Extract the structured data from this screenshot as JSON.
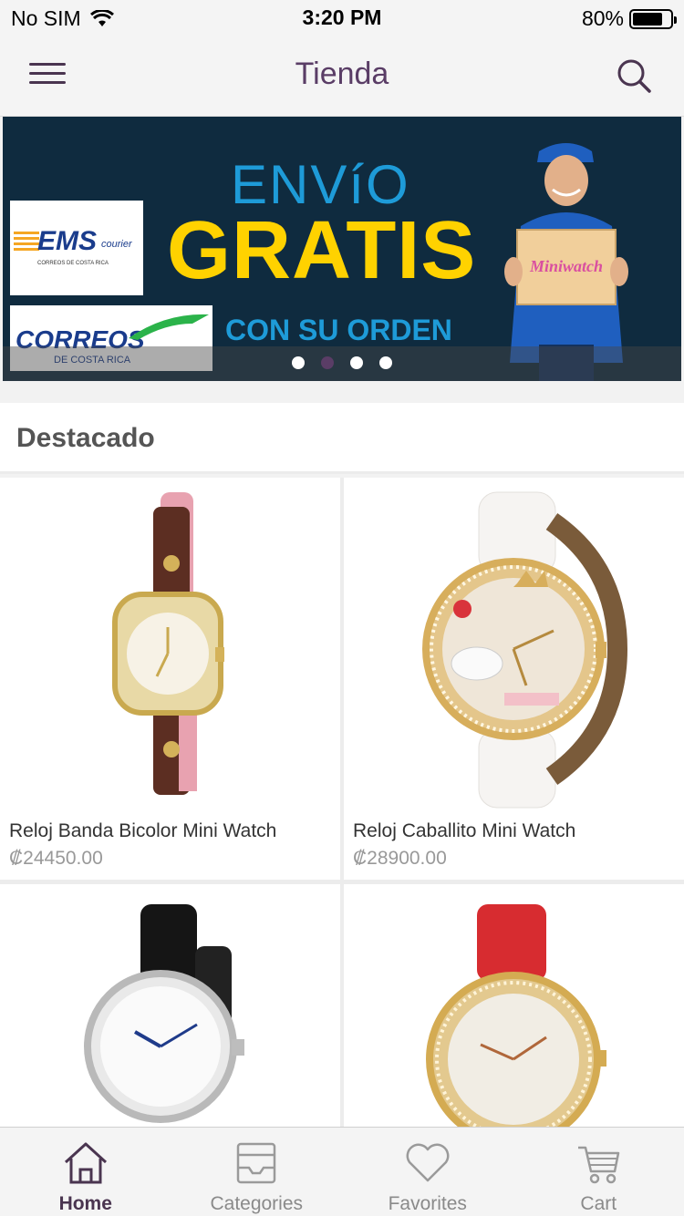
{
  "status_bar": {
    "carrier": "No SIM",
    "time": "3:20 PM",
    "battery": "80%",
    "battery_level": 0.8
  },
  "nav": {
    "title": "Tienda"
  },
  "banner": {
    "line1": "ENVíO",
    "line2": "GRATIS",
    "line3": "CON SU ORDEN",
    "ems_logo": "EMS",
    "ems_courier": "courier",
    "ems_sub": "CORREOS DE COSTA RICA",
    "correos_logo": "CORREOS",
    "correos_sub": "DE COSTA RICA",
    "box_brand": "Miniwatch",
    "dot_count": 4,
    "active_dot": 1
  },
  "section": {
    "title": "Destacado"
  },
  "products": [
    {
      "name": "Reloj Banda Bicolor Mini Watch",
      "price": "₡24450.00"
    },
    {
      "name": "Reloj Caballito Mini Watch",
      "price": "₡28900.00"
    },
    {
      "name": "",
      "price": ""
    },
    {
      "name": "",
      "price": ""
    }
  ],
  "tabs": [
    {
      "label": "Home",
      "icon": "home-icon",
      "active": true
    },
    {
      "label": "Categories",
      "icon": "inbox-icon",
      "active": false
    },
    {
      "label": "Favorites",
      "icon": "heart-icon",
      "active": false
    },
    {
      "label": "Cart",
      "icon": "cart-icon",
      "active": false
    }
  ],
  "colors": {
    "accent": "#5a3d66",
    "banner_bg": "#0f2b3f",
    "gratis": "#ffd200",
    "envio": "#1e9bd8"
  }
}
